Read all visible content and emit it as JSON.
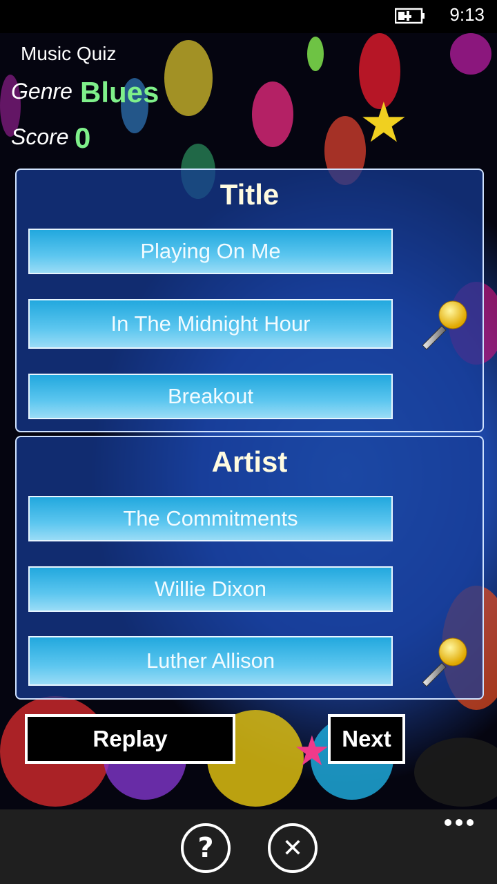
{
  "status": {
    "time": "9:13"
  },
  "header": {
    "app_title": "Music Quiz",
    "genre_label": "Genre",
    "genre_value": "Blues",
    "score_label": "Score",
    "score_value": "0"
  },
  "title_panel": {
    "heading": "Title",
    "options": [
      "Playing On Me",
      "In The Midnight Hour",
      "Breakout"
    ]
  },
  "artist_panel": {
    "heading": "Artist",
    "options": [
      "The Commitments",
      "Willie Dixon",
      "Luther Allison"
    ]
  },
  "actions": {
    "replay": "Replay",
    "next": "Next"
  },
  "app_bar": {
    "help_glyph": "?",
    "close_glyph": "✕"
  },
  "icons": [
    "battery-charging-icon",
    "microphone-icon",
    "help-icon",
    "close-icon",
    "more-icon"
  ],
  "colors": {
    "accent_green": "#7ff08a",
    "option_blue": "#22a8de",
    "panel_blue": "#163c96"
  }
}
